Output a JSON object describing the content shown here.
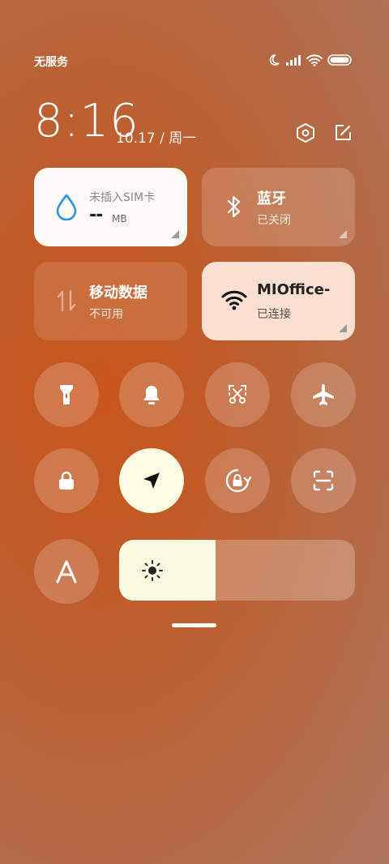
{
  "status": {
    "carrier": "无服务"
  },
  "header": {
    "time": "8:16",
    "date": "10.17 / 周一"
  },
  "tiles": {
    "data_usage": {
      "title": "未插入SIM卡",
      "value": "--",
      "unit": "MB"
    },
    "bluetooth": {
      "title": "蓝牙",
      "status": "已关闭"
    },
    "mobile_data": {
      "title": "移动数据",
      "status": "不可用"
    },
    "wifi": {
      "title": "MIOffice-",
      "status": "已连接"
    }
  },
  "toggles": [
    {
      "name": "flashlight",
      "icon": "flashlight-icon",
      "on": false
    },
    {
      "name": "mute",
      "icon": "bell-icon",
      "on": false
    },
    {
      "name": "screenshot",
      "icon": "scissors-icon",
      "on": false
    },
    {
      "name": "airplane-mode",
      "icon": "airplane-icon",
      "on": false
    },
    {
      "name": "lock-screen",
      "icon": "lock-icon",
      "on": false
    },
    {
      "name": "location",
      "icon": "navigation-arrow-icon",
      "on": true
    },
    {
      "name": "rotation-lock",
      "icon": "rotation-lock-icon",
      "on": false
    },
    {
      "name": "scanner",
      "icon": "scan-icon",
      "on": false
    },
    {
      "name": "font-size",
      "icon": "letter-a-icon",
      "on": false
    }
  ],
  "brightness": {
    "level": 0.41,
    "icon": "sun-icon"
  },
  "colors": {
    "accent_light": "#fcf9e2",
    "wifi_tile": "#fbe0d2",
    "water_drop": "#2a95e0"
  }
}
